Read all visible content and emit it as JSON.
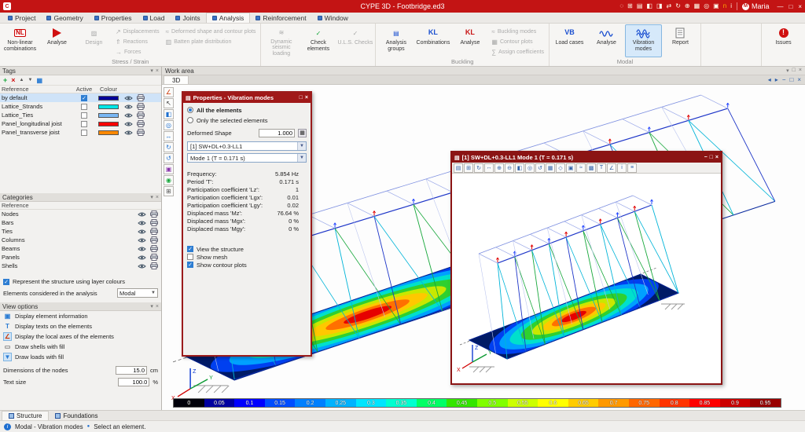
{
  "titlebar": {
    "title": "CYPE 3D - Footbridge.ed3",
    "user": "Maria",
    "right_icons": [
      {
        "name": "search-icon",
        "glyph": "◌"
      },
      {
        "name": "new-window-icon",
        "glyph": "⊞"
      },
      {
        "name": "print-icon",
        "glyph": "▤"
      },
      {
        "name": "zoom-window-icon",
        "glyph": "◧"
      },
      {
        "name": "zoom-extents-icon",
        "glyph": "◨"
      },
      {
        "name": "swap-view-icon",
        "glyph": "⇄"
      },
      {
        "name": "orbit-icon",
        "glyph": "↻"
      },
      {
        "name": "zoom-in-icon",
        "glyph": "⊕"
      },
      {
        "name": "grid-icon",
        "glyph": "▦"
      },
      {
        "name": "snap-icon",
        "glyph": "◎"
      },
      {
        "name": "layers-icon",
        "glyph": "▣"
      },
      {
        "name": "notifications-icon",
        "glyph": "n",
        "color": "#ffaa00"
      },
      {
        "name": "help-icon",
        "glyph": "i"
      }
    ],
    "window_controls": {
      "minimize": "—",
      "maximize": "□",
      "close": "×"
    }
  },
  "menubar": {
    "tabs": [
      {
        "label": "Project"
      },
      {
        "label": "Geometry"
      },
      {
        "label": "Properties"
      },
      {
        "label": "Load"
      },
      {
        "label": "Joints"
      },
      {
        "label": "Analysis",
        "active": true
      },
      {
        "label": "Reinforcement"
      },
      {
        "label": "Window"
      }
    ]
  },
  "ribbon": {
    "stress_strain": {
      "label": "Stress / Strain",
      "nl_glyph": "NL",
      "nonlinear": "Non-linear combinations",
      "analyse": "Analyse",
      "design": "Design",
      "displacements": "Displacements",
      "reactions": "Reactions",
      "forces": "Forces",
      "deformed": "Deformed shape and contour plots",
      "batten": "Batten plate distribution"
    },
    "checks": {
      "label": "",
      "dynamic_seismic": "Dynamic seismic loading",
      "check_elements": "Check elements",
      "uls_checks": "U.L.S. Checks"
    },
    "buckling": {
      "label": "Buckling",
      "kl_glyph": "KL",
      "analysis_groups": "Analysis groups",
      "combinations": "Combinations",
      "analyse": "Analyse",
      "buckling_modes": "Buckling modes",
      "contour_plots": "Contour plots",
      "assign_coefficients": "Assign coefficients"
    },
    "modal": {
      "label": "Modal",
      "vb_glyph": "VB",
      "load_cases": "Load cases",
      "analyse": "Analyse",
      "vibration_modes": "Vibration modes",
      "report": "Report"
    },
    "issues": "Issues"
  },
  "panel_icons": {
    "chevron": "▾",
    "close": "×"
  },
  "tags_panel": {
    "title": "Tags",
    "tools": {
      "add": "+",
      "delete": "×",
      "up": "▲",
      "down": "▼",
      "layers": "▦"
    },
    "columns": {
      "reference": "Reference",
      "active": "Active",
      "colour": "Colour"
    },
    "rows": [
      {
        "reference": "by default",
        "active": true,
        "colour": "#000099",
        "selected": true
      },
      {
        "reference": "Lattice_Strands",
        "active": false,
        "colour": "#00e5e5"
      },
      {
        "reference": "Lattice_Ties",
        "active": false,
        "colour": "#7ab8f5"
      },
      {
        "reference": "Panel_longitudinal joist",
        "active": false,
        "colour": "#ff0000"
      },
      {
        "reference": "Panel_transverse joist",
        "active": false,
        "colour": "#ff8800"
      }
    ]
  },
  "categories_panel": {
    "title": "Categories",
    "column": "Reference",
    "rows": [
      "Nodes",
      "Bars",
      "Ties",
      "Columns",
      "Beams",
      "Panels",
      "Shells"
    ]
  },
  "layer_options": {
    "represent_layers": "Represent the structure using layer colours",
    "represent_layers_checked": true,
    "elements_considered": "Elements considered in the analysis",
    "elements_considered_value": "Modal"
  },
  "view_options": {
    "title": "View options",
    "items": [
      {
        "label": "Display element information",
        "glyph": "▣",
        "color": "#2b7cd3",
        "pressed": false
      },
      {
        "label": "Display texts on the elements",
        "glyph": "T",
        "color": "#2b7cd3",
        "pressed": false
      },
      {
        "label": "Display the local axes of the elements",
        "glyph": "∠",
        "color": "#cc3300",
        "pressed": true
      },
      {
        "label": "Draw shells with fill",
        "glyph": "▭",
        "color": "#777777",
        "pressed": false
      },
      {
        "label": "Draw loads with fill",
        "glyph": "▼",
        "color": "#2b7cd3",
        "pressed": true
      }
    ],
    "dimensions_label": "Dimensions of the nodes",
    "dimensions_value": "15.0",
    "dimensions_unit": "cm",
    "textsize_label": "Text size",
    "textsize_value": "100.0",
    "textsize_unit": "%"
  },
  "workarea": {
    "header": "Work area",
    "tab": "3D",
    "axes": {
      "x": "X",
      "y": "Y",
      "z": "Z"
    },
    "header_icons": [
      {
        "name": "chevron-down-icon",
        "glyph": "▾"
      },
      {
        "name": "float-icon",
        "glyph": "□"
      },
      {
        "name": "close-icon",
        "glyph": "×"
      }
    ],
    "tab_icons": [
      {
        "name": "prev-view-icon",
        "glyph": "◂"
      },
      {
        "name": "next-view-icon",
        "glyph": "▸"
      },
      {
        "name": "minimize-icon",
        "glyph": "−"
      },
      {
        "name": "restore-icon",
        "glyph": "□"
      },
      {
        "name": "close-icon",
        "glyph": "×"
      }
    ],
    "left_toolbar": [
      {
        "name": "axes-icon",
        "glyph": "∠",
        "color": "#cc3300"
      },
      {
        "name": "select-icon",
        "glyph": "↖",
        "color": "#333333"
      },
      {
        "name": "zoom-window-icon",
        "glyph": "◧",
        "color": "#1e6fd0"
      },
      {
        "name": "zoom-extents-icon",
        "glyph": "◎",
        "color": "#1e6fd0"
      },
      {
        "name": "pan-icon",
        "glyph": "↔",
        "color": "#1e6fd0"
      },
      {
        "name": "orbit-icon",
        "glyph": "↻",
        "color": "#1e6fd0"
      },
      {
        "name": "previous-view-icon",
        "glyph": "↺",
        "color": "#1e6fd0"
      },
      {
        "name": "layers-icon",
        "glyph": "▣",
        "color": "#8833aa"
      },
      {
        "name": "visibility-icon",
        "glyph": "◉",
        "color": "#18a83c"
      },
      {
        "name": "capture-icon",
        "glyph": "⊞",
        "color": "#555555"
      }
    ]
  },
  "properties_dialog": {
    "title": "Properties - Vibration modes",
    "controls": {
      "maximize": "□",
      "close": "×"
    },
    "radio_all": "All the elements",
    "radio_selected": "Only the selected elements",
    "deformed_shape_label": "Deformed Shape",
    "deformed_shape_value": "1.000",
    "combo_loadcase": "[1] SW+DL+0.3-LL1",
    "combo_mode": "Mode 1 (T = 0.171 s)",
    "fields": [
      {
        "label": "Frequency:",
        "value": "5.854 Hz"
      },
      {
        "label": "Period 'T':",
        "value": "0.171 s"
      },
      {
        "label": "Participation coefficient 'Lz':",
        "value": "1"
      },
      {
        "label": "Participation coefficient 'Lgx':",
        "value": "0.01"
      },
      {
        "label": "Participation coefficient 'Lgy':",
        "value": "0.02"
      },
      {
        "label": "Displaced mass 'Mz':",
        "value": "76.64 %"
      },
      {
        "label": "Displaced mass 'Mgx':",
        "value": "0 %"
      },
      {
        "label": "Displaced mass 'Mgy':",
        "value": "0 %"
      }
    ],
    "checks": [
      {
        "label": "View the structure",
        "checked": true
      },
      {
        "label": "Show mesh",
        "checked": false
      },
      {
        "label": "Show contour plots",
        "checked": true
      }
    ]
  },
  "mode_window": {
    "title": "[1] SW+DL+0.3-LL1 Mode 1 (T = 0.171 s)",
    "controls": {
      "minimize": "−",
      "maximize": "□",
      "close": "×"
    },
    "toolbar": [
      {
        "name": "print-icon",
        "glyph": "▤"
      },
      {
        "name": "copy-icon",
        "glyph": "⊞"
      },
      {
        "name": "orbit-icon",
        "glyph": "↻"
      },
      {
        "name": "pan-icon",
        "glyph": "↔"
      },
      {
        "name": "zoom-in-icon",
        "glyph": "⊕"
      },
      {
        "name": "zoom-out-icon",
        "glyph": "⊖"
      },
      {
        "name": "zoom-window-icon",
        "glyph": "◧"
      },
      {
        "name": "zoom-extents-icon",
        "glyph": "◎"
      },
      {
        "name": "previous-view-icon",
        "glyph": "↺"
      },
      {
        "name": "views-icon",
        "glyph": "▦"
      },
      {
        "name": "perspective-icon",
        "glyph": "◇"
      },
      {
        "name": "layers-icon",
        "glyph": "▣"
      },
      {
        "name": "contour-icon",
        "glyph": "≈"
      },
      {
        "name": "mesh-icon",
        "glyph": "▩"
      },
      {
        "name": "texts-icon",
        "glyph": "T"
      },
      {
        "name": "local-axes-icon",
        "glyph": "∠"
      },
      {
        "name": "info-icon",
        "glyph": "i"
      },
      {
        "name": "settings-icon",
        "glyph": "≡"
      }
    ]
  },
  "scale": {
    "segments": [
      {
        "label": "0",
        "color": "#00000a"
      },
      {
        "label": "0.05",
        "color": "#0000a0"
      },
      {
        "label": "0.1",
        "color": "#0000ff"
      },
      {
        "label": "0.15",
        "color": "#004dff"
      },
      {
        "label": "0.2",
        "color": "#0080ff"
      },
      {
        "label": "0.25",
        "color": "#00b3ff"
      },
      {
        "label": "0.3",
        "color": "#00e5ff"
      },
      {
        "label": "0.35",
        "color": "#00ffd0"
      },
      {
        "label": "0.4",
        "color": "#00ff66"
      },
      {
        "label": "0.45",
        "color": "#33e600"
      },
      {
        "label": "0.5",
        "color": "#80ff00"
      },
      {
        "label": "0.55",
        "color": "#ccff00"
      },
      {
        "label": "0.6",
        "color": "#ffff00"
      },
      {
        "label": "0.65",
        "color": "#ffcc00"
      },
      {
        "label": "0.7",
        "color": "#ff9900"
      },
      {
        "label": "0.75",
        "color": "#ff6600"
      },
      {
        "label": "0.8",
        "color": "#ff3300"
      },
      {
        "label": "0.85",
        "color": "#ff0000"
      },
      {
        "label": "0.9",
        "color": "#cc0000"
      },
      {
        "label": "0.95",
        "color": "#990000"
      }
    ]
  },
  "statusbar": {
    "tabs": [
      {
        "label": "Structure",
        "active": true
      },
      {
        "label": "Foundations",
        "active": false
      }
    ],
    "mode_text": "Modal - Vibration modes",
    "hint": "Select an element."
  }
}
